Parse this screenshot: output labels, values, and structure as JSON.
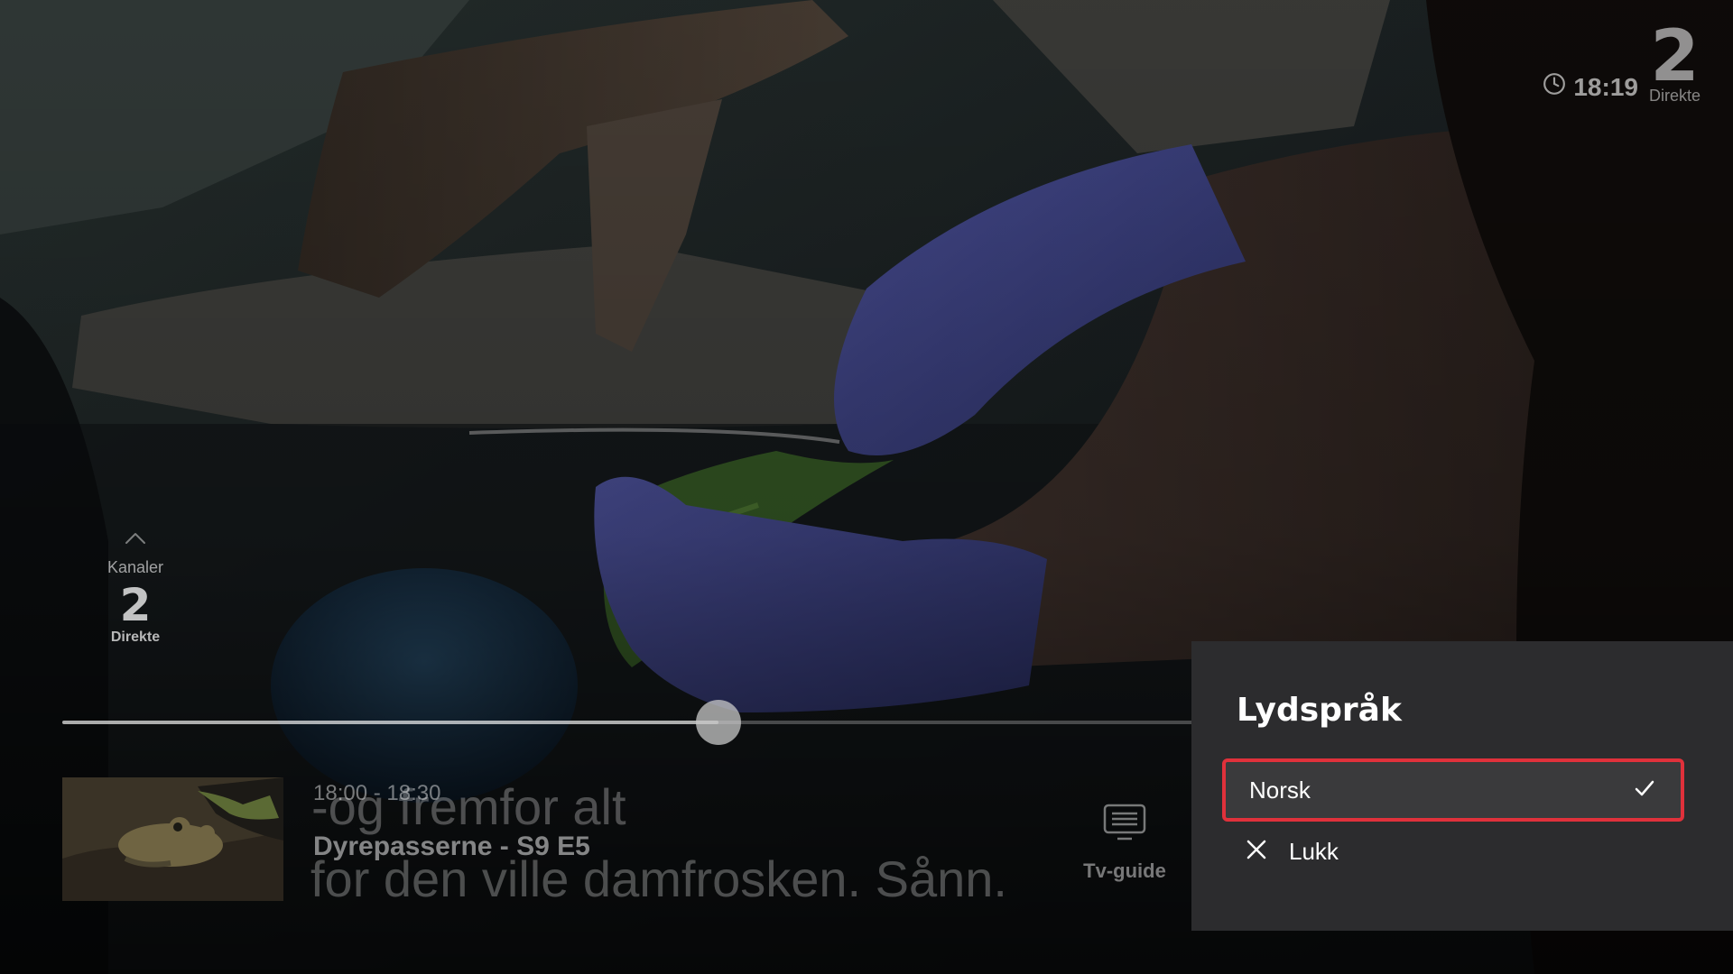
{
  "header": {
    "time": "18:19",
    "channel_number": "2",
    "channel_status": "Direkte"
  },
  "channel_switcher": {
    "label": "Kanaler",
    "channel_number": "2",
    "channel_status": "Direkte"
  },
  "player": {
    "progress_fraction": 0.58
  },
  "program": {
    "time_range": "18:00 - 18:30",
    "title": "Dyrepasserne - S9 E5"
  },
  "subtitles": {
    "line1": "-og fremfor alt",
    "line2": "for den ville damfrosken. Sånn."
  },
  "tv_guide": {
    "label": "Tv-guide"
  },
  "audio_panel": {
    "title": "Lydspråk",
    "options": [
      {
        "label": "Norsk",
        "selected": true
      }
    ],
    "close_label": "Lukk",
    "accent_color": "#e0313b",
    "background_color": "#2c2c2e"
  },
  "icons": {
    "clock": "clock-icon",
    "chevron_up": "chevron-up-icon",
    "tv_guide": "tv-guide-icon",
    "check": "check-icon",
    "close": "close-icon"
  }
}
